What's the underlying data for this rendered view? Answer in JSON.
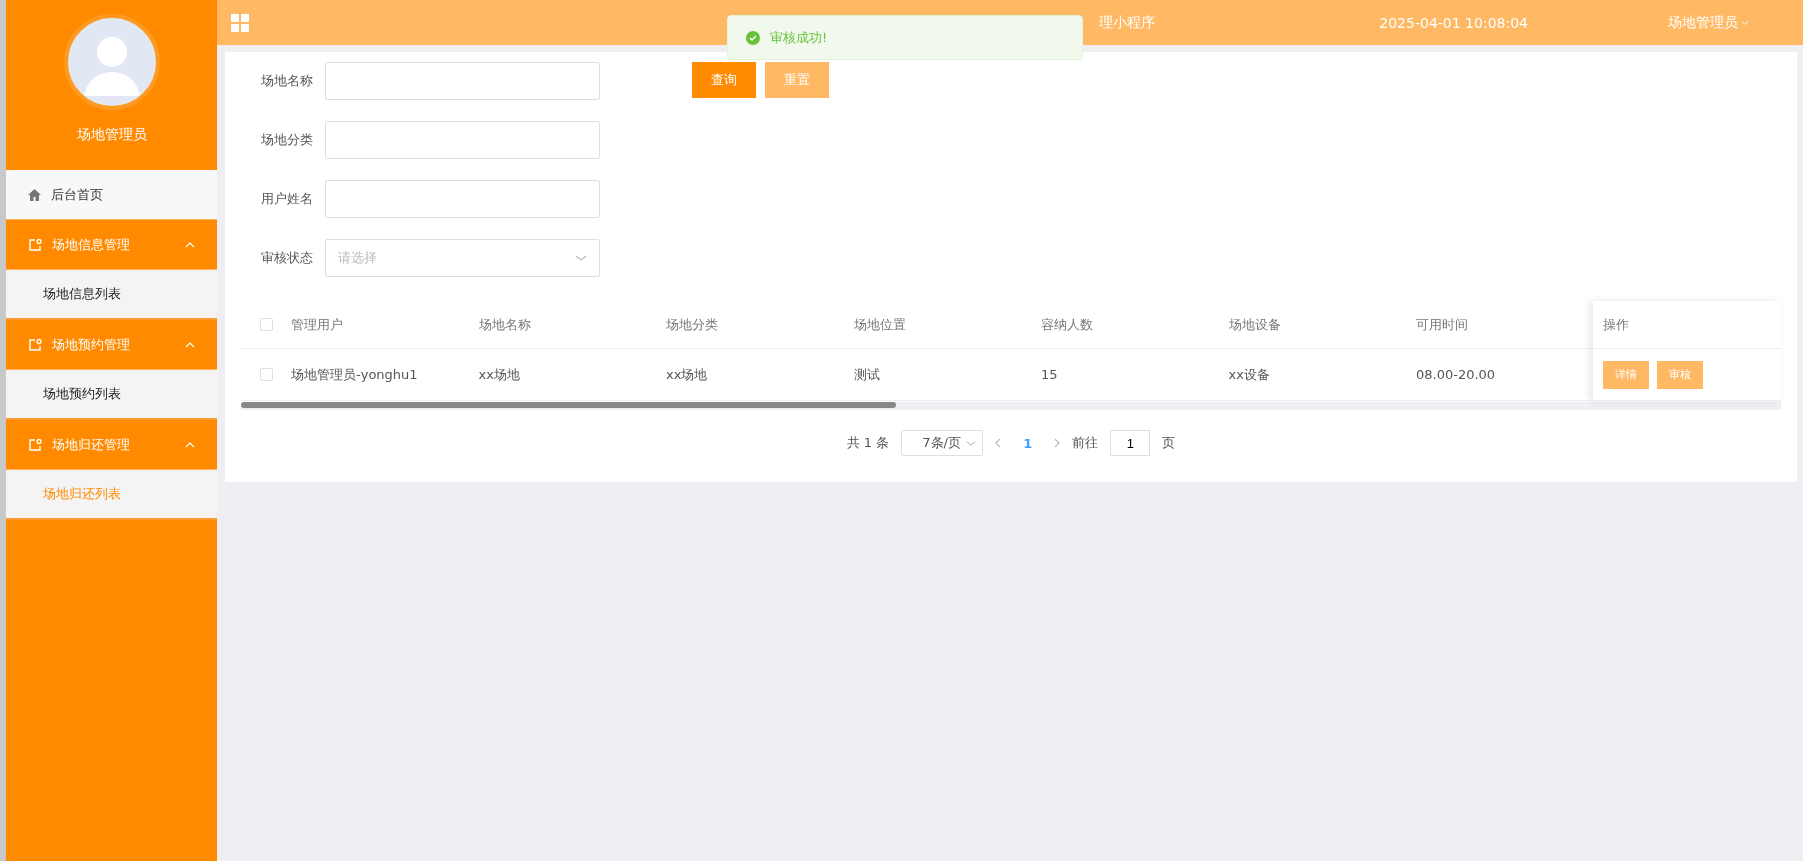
{
  "sidebar": {
    "user_name": "场地管理员",
    "menu": [
      {
        "label": "后台首页",
        "kind": "home"
      },
      {
        "label": "场地信息管理",
        "kind": "group",
        "expanded": true,
        "children": [
          {
            "label": "场地信息列表",
            "selected": false
          }
        ]
      },
      {
        "label": "场地预约管理",
        "kind": "group",
        "expanded": true,
        "children": [
          {
            "label": "场地预约列表",
            "selected": false
          }
        ]
      },
      {
        "label": "场地归还管理",
        "kind": "group",
        "expanded": true,
        "children": [
          {
            "label": "场地归还列表",
            "selected": true
          }
        ]
      }
    ]
  },
  "header": {
    "title": "理小程序",
    "datetime": "2025-04-01 10:08:04",
    "user_menu": "场地管理员"
  },
  "toast": {
    "message": "审核成功!"
  },
  "search_form": {
    "fields": [
      {
        "label": "场地名称",
        "kind": "input"
      },
      {
        "label": "场地分类",
        "kind": "input"
      },
      {
        "label": "用户姓名",
        "kind": "input"
      },
      {
        "label": "审核状态",
        "kind": "select",
        "placeholder": "请选择"
      }
    ],
    "buttons": [
      {
        "label": "查询",
        "kind": "primary"
      },
      {
        "label": "重置",
        "kind": "secondary"
      }
    ]
  },
  "table": {
    "select_all_checked": false,
    "columns": [
      "管理用户",
      "场地名称",
      "场地分类",
      "场地位置",
      "容纳人数",
      "场地设备",
      "可用时间"
    ],
    "action_column": "操作",
    "rows": [
      {
        "checked": false,
        "cells": [
          "场地管理员-yonghu1",
          "xx场地",
          "xx场地",
          "测试",
          "15",
          "xx设备",
          "08.00-20.00"
        ],
        "actions": [
          "详情",
          "审核"
        ]
      }
    ]
  },
  "pagination": {
    "total": "共 1 条",
    "page_size": "7条/页",
    "pages": [
      {
        "label": "1",
        "selected": true
      }
    ],
    "goto_label": "前往",
    "goto_value": "1",
    "goto_suffix": "页"
  }
}
